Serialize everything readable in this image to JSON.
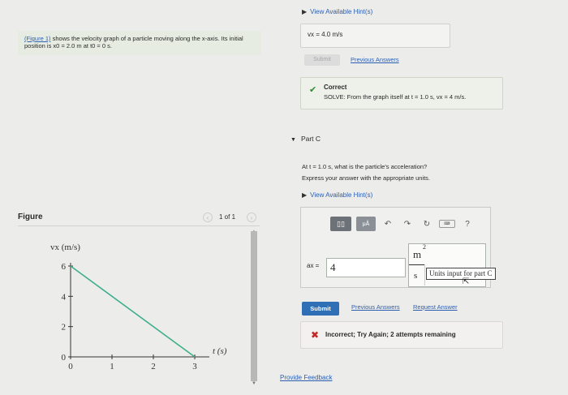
{
  "problem": {
    "figure_link": "(Figure 1)",
    "text": "shows the velocity graph of a particle moving along the x-axis. Its initial position is x0 = 2.0 m at t0 = 0 s."
  },
  "figure": {
    "label": "Figure",
    "pager_text": "1 of 1",
    "prev_icon": "chevron-left-icon",
    "next_icon": "chevron-right-icon"
  },
  "chart_data": {
    "type": "line",
    "x": [
      0,
      3
    ],
    "values": [
      6,
      0
    ],
    "ylabel": "vx (m/s)",
    "xlabel": "t (s)",
    "xlim": [
      0,
      3
    ],
    "ylim": [
      0,
      6
    ],
    "x_ticks": [
      "0",
      "1",
      "2",
      "3"
    ],
    "y_ticks": [
      "0",
      "2",
      "4",
      "6"
    ],
    "line_color": "#3fae8e",
    "grid": false
  },
  "part_b": {
    "hints_label": "View Available Hint(s)",
    "answer_text": "vx = 4.0 m/s",
    "submit_label": "Submit",
    "previous_answers": "Previous Answers",
    "correct_title": "Correct",
    "correct_text": "SOLVE: From the graph itself at t = 1.0 s, vx = 4 m/s."
  },
  "part_c": {
    "title": "Part C",
    "question": "At t = 1.0 s, what is the particle's acceleration?",
    "instruction": "Express your answer with the appropriate units.",
    "hints_label": "View Available Hint(s)",
    "variable": "ax =",
    "value": "4",
    "unit_num": "m",
    "unit_exp": "2",
    "unit_den": "s",
    "units_tooltip": "Units input for part C",
    "submit_label": "Submit",
    "previous_answers": "Previous Answers",
    "request_answer": "Request Answer",
    "feedback": "Incorrect; Try Again; 2 attempts remaining",
    "toolbar": {
      "template": "▯▯",
      "mu": "μÅ",
      "undo": "↶",
      "redo": "↷",
      "reset": "↻",
      "keyboard": "⌨",
      "help": "?"
    }
  },
  "footer": {
    "provide_feedback": "Provide Feedback"
  },
  "colors": {
    "link": "#2d5fb0",
    "submit": "#2e6fb6",
    "correct": "#2e8b2e",
    "incorrect": "#c62828"
  }
}
